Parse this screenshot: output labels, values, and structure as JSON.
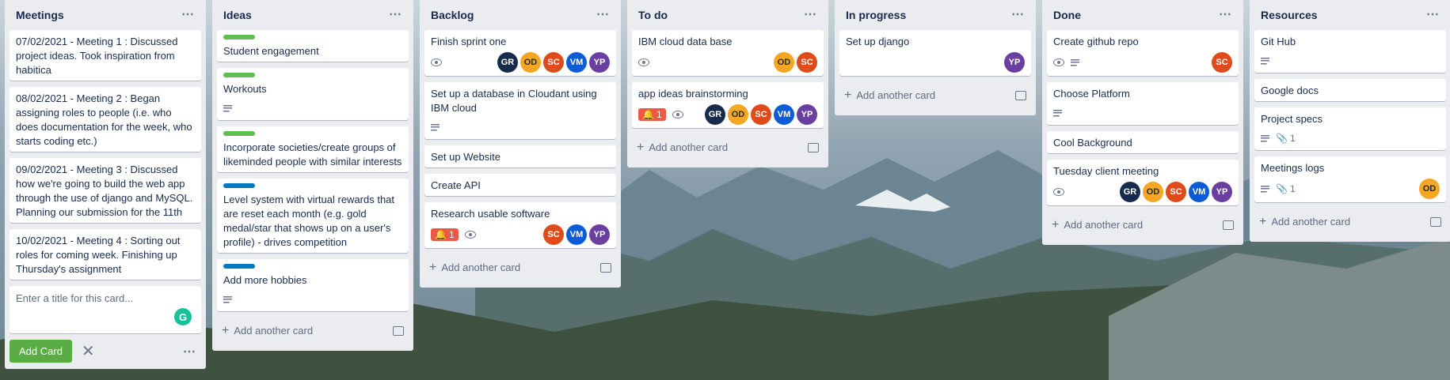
{
  "colors": {
    "green_label": "#61bd4f",
    "blue_label": "#0079bf",
    "gr": "#172b4d",
    "od": "#f5a623",
    "sc": "#e04b1a",
    "vm": "#0b5cd5",
    "yp": "#6b3fa0"
  },
  "lists": [
    {
      "title": "Meetings",
      "cards": [
        {
          "title": "07/02/2021 - Meeting 1 : Discussed project ideas. Took inspiration from habitica"
        },
        {
          "title": "08/02/2021 - Meeting 2 : Began assigning roles to people (i.e. who does documentation for the week, who starts coding etc.)"
        },
        {
          "title": "09/02/2021 - Meeting 3 : Discussed how we're going to build the web app through the use of django and MySQL. Planning our submission for the 11th"
        },
        {
          "title": "10/02/2021 - Meeting 4 : Sorting out roles for coming week. Finishing up Thursday's assignment"
        }
      ],
      "composer": {
        "placeholder": "Enter a title for this card...",
        "add_card": "Add Card"
      }
    },
    {
      "title": "Ideas",
      "cards": [
        {
          "title": "Student engagement"
        },
        {
          "title": "Workouts"
        },
        {
          "title": "Incorporate societies/create groups of likeminded people with similar interests"
        },
        {
          "title": "Level system with virtual rewards that are reset each month (e.g. gold medal/star that shows up on a user's profile) - drives competition"
        },
        {
          "title": "Add more hobbies"
        }
      ],
      "add_another": "Add another card"
    },
    {
      "title": "Backlog",
      "cards": [
        {
          "title": "Finish sprint one",
          "members": [
            "GR",
            "OD",
            "SC",
            "VM",
            "YP"
          ]
        },
        {
          "title": "Set up a database in Cloudant using IBM cloud"
        },
        {
          "title": "Set up Website"
        },
        {
          "title": "Create API"
        },
        {
          "title": "Research usable software",
          "bell": "1",
          "members": [
            "SC",
            "VM",
            "YP"
          ]
        }
      ],
      "add_another": "Add another card"
    },
    {
      "title": "To do",
      "cards": [
        {
          "title": "IBM cloud data base",
          "members": [
            "OD",
            "SC"
          ]
        },
        {
          "title": "app ideas brainstorming",
          "bell": "1",
          "members": [
            "GR",
            "OD",
            "SC",
            "VM",
            "YP"
          ]
        }
      ],
      "add_another": "Add another card"
    },
    {
      "title": "In progress",
      "cards": [
        {
          "title": "Set up django",
          "members": [
            "YP"
          ]
        }
      ],
      "add_another": "Add another card"
    },
    {
      "title": "Done",
      "cards": [
        {
          "title": "Create github repo",
          "members": [
            "SC"
          ]
        },
        {
          "title": "Choose Platform"
        },
        {
          "title": "Cool Background"
        },
        {
          "title": "Tuesday client meeting",
          "members": [
            "GR",
            "OD",
            "SC",
            "VM",
            "YP"
          ]
        }
      ],
      "add_another": "Add another card"
    },
    {
      "title": "Resources",
      "cards": [
        {
          "title": "Git Hub"
        },
        {
          "title": "Google docs"
        },
        {
          "title": "Project specs",
          "attachments": "1"
        },
        {
          "title": "Meetings logs",
          "attachments": "1",
          "members": [
            "OD"
          ]
        }
      ],
      "add_another": "Add another card"
    }
  ],
  "icons": {
    "list_menu": "⋯",
    "bell": "🔔",
    "paperclip": "📎",
    "plus": "+",
    "close": "✕",
    "grammarly": "G"
  }
}
